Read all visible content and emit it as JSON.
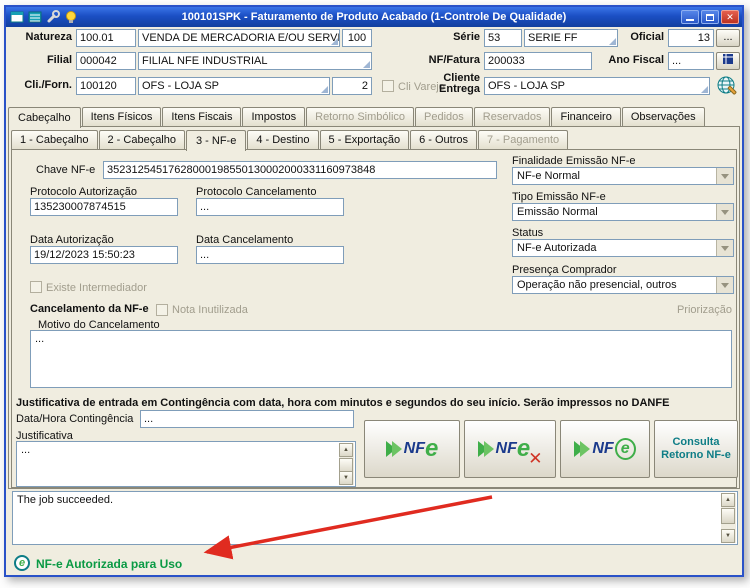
{
  "window": {
    "title": "100101SPK - Faturamento de Produto Acabado (1-Controle De Qualidade)"
  },
  "icons": {
    "close": "✕",
    "red_x": "✕",
    "arrow_up": "▲",
    "arrow_down": "▼"
  },
  "colors": {
    "titlebar_blue": "#1b4fc4",
    "status_green": "#0a9a44",
    "annotation_red": "#e02b20",
    "nfe_green": "#3fae49",
    "nfe_navy": "#1b3a8c",
    "field_border": "#7f9db9"
  },
  "header": {
    "natureza_label": "Natureza",
    "natureza_code": "100.01",
    "natureza_desc": "VENDA DE MERCADORIA E/OU SERVI",
    "natureza_extra": "100",
    "serie_label": "Série",
    "serie_code": "53",
    "serie_desc": "SERIE FF",
    "oficial_label": "Oficial",
    "oficial_value": "13",
    "oficial_button": "...",
    "filial_label": "Filial",
    "filial_code": "000042",
    "filial_desc": "FILIAL NFE INDUSTRIAL",
    "nf_fatura_label": "NF/Fatura",
    "nf_fatura_value": "200033",
    "ano_fiscal_label": "Ano Fiscal",
    "ano_fiscal_value": "...",
    "cli_forn_label": "Cli./Forn.",
    "cli_forn_code": "100120",
    "cli_forn_desc": "OFS - LOJA SP",
    "cli_forn_qty": "2",
    "cli_varejo_label": "Cli Varejo",
    "cliente_entrega_label": "Cliente Entrega",
    "cliente_entrega_value": "OFS - LOJA SP"
  },
  "tabs_main": [
    {
      "label": "Cabeçalho",
      "state": "active"
    },
    {
      "label": "Itens Físicos",
      "state": "normal"
    },
    {
      "label": "Itens Fiscais",
      "state": "normal"
    },
    {
      "label": "Impostos",
      "state": "normal"
    },
    {
      "label": "Retorno Simbólico",
      "state": "disabled"
    },
    {
      "label": "Pedidos",
      "state": "disabled"
    },
    {
      "label": "Reservados",
      "state": "disabled"
    },
    {
      "label": "Financeiro",
      "state": "normal"
    },
    {
      "label": "Observações",
      "state": "normal"
    }
  ],
  "tabs_sub": [
    {
      "label": "1 - Cabeçalho",
      "state": "normal"
    },
    {
      "label": "2 - Cabeçalho",
      "state": "normal"
    },
    {
      "label": "3 - NF-e",
      "state": "active"
    },
    {
      "label": "4 - Destino",
      "state": "normal"
    },
    {
      "label": "5 - Exportação",
      "state": "normal"
    },
    {
      "label": "6 - Outros",
      "state": "normal"
    },
    {
      "label": "7 - Pagamento",
      "state": "disabled"
    }
  ],
  "nfe": {
    "chave_label": "Chave NF-e",
    "chave_value": "35231254517628000198550130002000331160973848",
    "prot_aut_label": "Protocolo Autorização",
    "prot_aut_value": "135230007874515",
    "prot_canc_label": "Protocolo Cancelamento",
    "prot_canc_value": "...",
    "data_aut_label": "Data Autorização",
    "data_aut_value": "19/12/2023 15:50:23",
    "data_canc_label": "Data Cancelamento",
    "data_canc_value": "...",
    "existe_intermediador_label": "Existe Intermediador",
    "finalidade_label": "Finalidade Emissão NF-e",
    "finalidade_value": "NF-e Normal",
    "tipo_emissao_label": "Tipo Emissão NF-e",
    "tipo_emissao_value": "Emissão Normal",
    "status_label": "Status",
    "status_value": "NF-e Autorizada",
    "presenca_label": "Presença Comprador",
    "presenca_value": "Operação não presencial, outros",
    "cancelamento_title": "Cancelamento da NF-e",
    "nota_inutilizada_label": "Nota Inutilizada",
    "priorizacao_label": "Priorização",
    "motivo_label": "Motivo do Cancelamento",
    "motivo_value": "...",
    "contingencia_text": "Justificativa de entrada em Contingência com data, hora com minutos e segundos do seu início. Serão impressos no DANFE",
    "data_hora_cont_label": "Data/Hora Contingência",
    "data_hora_cont_value": "...",
    "justificativa_label": "Justificativa",
    "justificativa_value": "..."
  },
  "buttons": {
    "logo_nf": "NF",
    "logo_e": "e",
    "consulta_retorno": "Consulta Retorno NF-e"
  },
  "log": {
    "text": "The job succeeded."
  },
  "statusbar": {
    "message": "NF-e Autorizada para Uso"
  }
}
